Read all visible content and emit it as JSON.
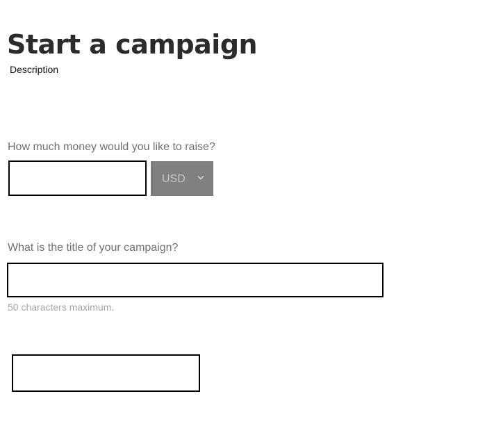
{
  "page": {
    "title": "Start a campaign",
    "description": "Description"
  },
  "amount_field": {
    "label": "How much money would you like to raise?",
    "value": ""
  },
  "currency_select": {
    "selected": "USD",
    "icon": "chevron-down-icon"
  },
  "title_field": {
    "label": "What is the title of your campaign?",
    "value": "",
    "helper": "50 characters maximum."
  },
  "extra_field": {
    "value": ""
  },
  "colors": {
    "title_text": "#2b2b2b",
    "label_text": "#707070",
    "helper_text": "#a6a6a6",
    "select_background": "#808080",
    "select_text": "#c4c4c4",
    "input_border": "#000000"
  }
}
